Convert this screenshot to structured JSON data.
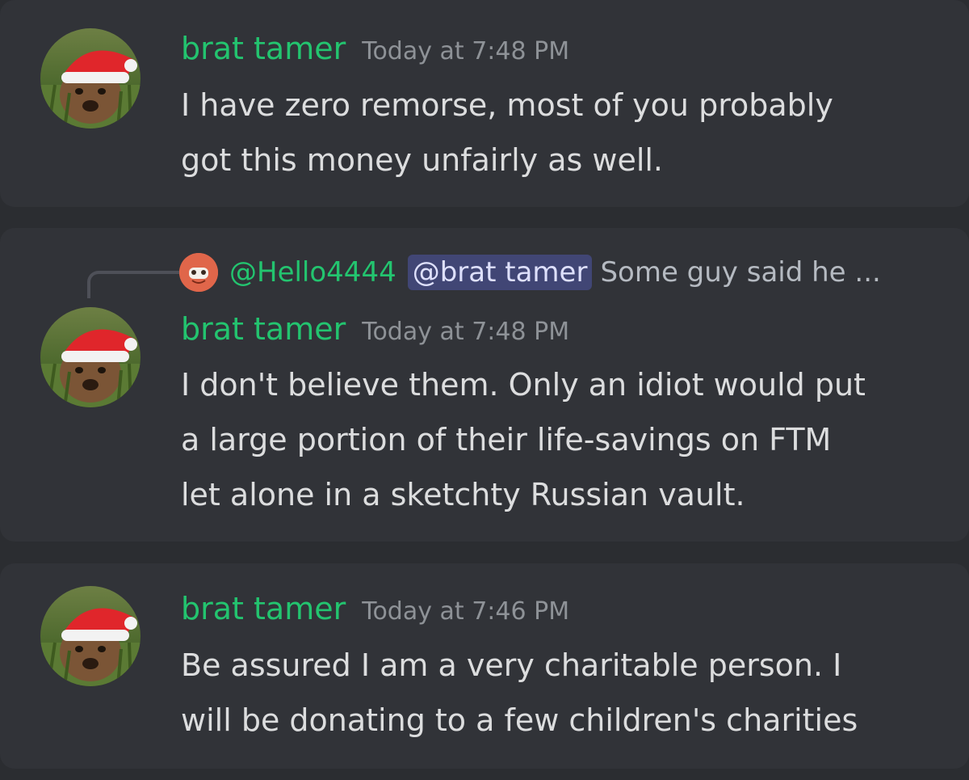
{
  "messages": [
    {
      "author": "brat tamer",
      "timestamp": "Today at 7:48 PM",
      "lines": [
        "I have zero remorse, most of you probably",
        "got this money unfairly as well."
      ]
    },
    {
      "reply": {
        "user": "@Hello4444",
        "mention": "@brat tamer",
        "text": "Some guy said he ..."
      },
      "author": "brat tamer",
      "timestamp": "Today at 7:48 PM",
      "lines": [
        "I don't believe them. Only an idiot would put",
        "a large portion of their life-savings on FTM",
        "let alone in a sketchty Russian vault."
      ]
    },
    {
      "author": "brat tamer",
      "timestamp": "Today at 7:46 PM",
      "lines": [
        "Be assured I am a very charitable person. I",
        "will be donating to a few children's charities"
      ]
    }
  ],
  "icons": {
    "avatar": "bear-santa-hat-avatar",
    "reply_avatar": "orange-face-avatar"
  },
  "colors": {
    "background": "#2b2d31",
    "message_bg": "#313338",
    "author": "#23c46f",
    "text": "#dcddde",
    "timestamp": "#8e9297",
    "mention_bg": "#414675"
  }
}
